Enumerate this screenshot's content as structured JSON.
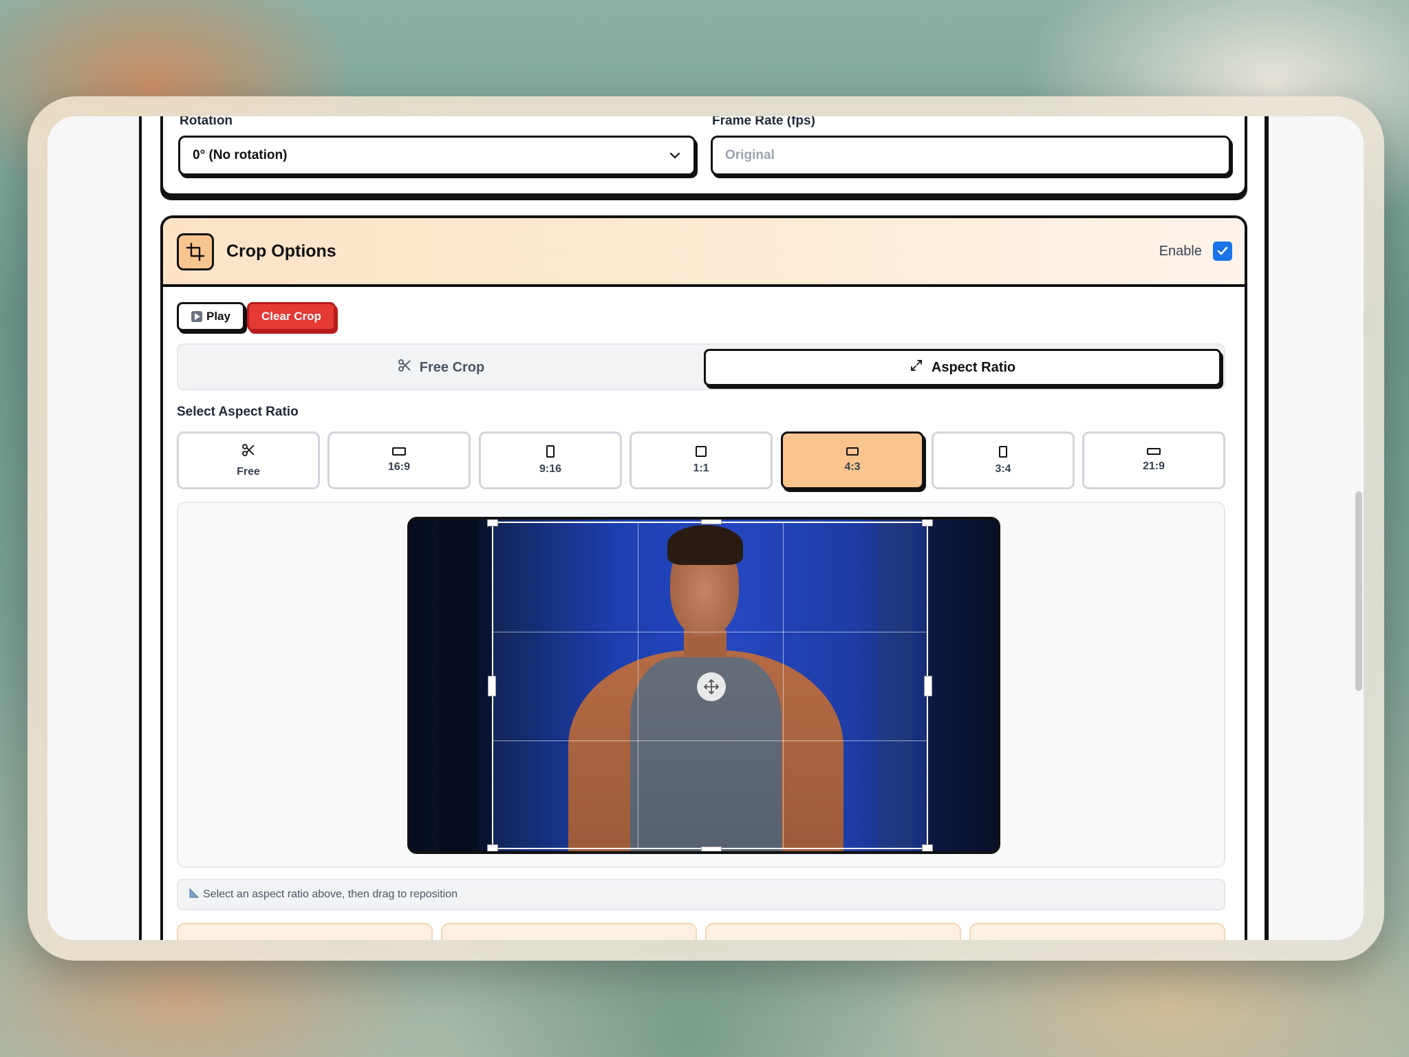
{
  "settings": {
    "rotation": {
      "label": "Rotation",
      "value": "0° (No rotation)"
    },
    "frame_rate": {
      "label": "Frame Rate (fps)",
      "placeholder": "Original"
    }
  },
  "crop": {
    "title": "Crop Options",
    "enable_label": "Enable",
    "enabled": true,
    "play_label": "Play",
    "clear_label": "Clear Crop",
    "tabs": {
      "free": "Free Crop",
      "aspect": "Aspect Ratio",
      "active": "aspect"
    },
    "select_label": "Select Aspect Ratio",
    "ratios": [
      {
        "label": "Free",
        "icon": "scissors-icon",
        "active": false
      },
      {
        "label": "16:9",
        "icon": "landscape-rect-icon",
        "active": false
      },
      {
        "label": "9:16",
        "icon": "portrait-rect-icon",
        "active": false
      },
      {
        "label": "1:1",
        "icon": "square-icon",
        "active": false
      },
      {
        "label": "4:3",
        "icon": "landscape-rect-icon",
        "active": true
      },
      {
        "label": "3:4",
        "icon": "portrait-rect-icon",
        "active": false
      },
      {
        "label": "21:9",
        "icon": "wide-rect-icon",
        "active": false
      }
    ],
    "hint": "Select an aspect ratio above, then drag to reposition",
    "hint_icon": "ruler-icon"
  },
  "colors": {
    "accent": "#f9c48e",
    "danger": "#e53935",
    "checkbox": "#1a73e8"
  }
}
